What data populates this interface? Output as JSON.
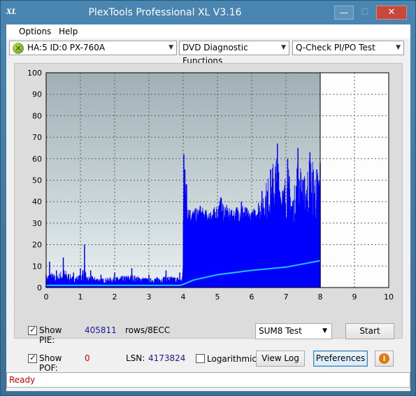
{
  "window": {
    "title": "PlexTools Professional XL V3.16",
    "icon_text": "XL",
    "min_glyph": "—",
    "max_glyph": "☐",
    "close_glyph": "✕"
  },
  "menu": {
    "options": "Options",
    "help": "Help"
  },
  "toolbar": {
    "device": "HA:5 ID:0  PX-760A",
    "function": "DVD Diagnostic Functions",
    "test": "Q-Check PI/PO Test"
  },
  "chart_data": {
    "type": "area",
    "x_ticks": [
      "0",
      "1",
      "2",
      "3",
      "4",
      "5",
      "6",
      "7",
      "8",
      "9",
      "10"
    ],
    "y_ticks": [
      "0",
      "10",
      "20",
      "30",
      "40",
      "50",
      "60",
      "70",
      "80",
      "90",
      "100"
    ],
    "xlim": [
      0,
      10
    ],
    "ylim": [
      0,
      100
    ],
    "grid": true,
    "cursor_x": 8,
    "colors": {
      "pie": "#0000ff",
      "cumulative": "#22c4ff",
      "bg_top": "#9fb0b5",
      "bg_bottom": "#e8eff0"
    },
    "series": [
      {
        "values_x": [
          0,
          0.1,
          0.3,
          0.5,
          0.8,
          1.0,
          1.12,
          1.15,
          1.3,
          1.6,
          2.0,
          2.5,
          3.0,
          3.5,
          3.9,
          3.98,
          4.02,
          4.05,
          4.1,
          4.2,
          4.5,
          4.8,
          5.1,
          5.4,
          5.7,
          6.0,
          6.3,
          6.55,
          6.75,
          6.9,
          7.05,
          7.2,
          7.35,
          7.5,
          7.7,
          7.9,
          8.0
        ],
        "values_y": [
          6,
          12,
          8,
          14,
          7,
          9,
          20,
          7,
          8,
          6,
          7,
          9,
          6,
          8,
          7,
          5,
          62,
          55,
          48,
          36,
          38,
          35,
          42,
          36,
          40,
          35,
          45,
          55,
          67,
          45,
          60,
          40,
          65,
          50,
          63,
          55,
          58
        ]
      },
      {
        "values_x": [
          0,
          1,
          2,
          3,
          3.9,
          4.0,
          4.3,
          5.0,
          6.0,
          7.0,
          8.0
        ],
        "values_y": [
          1,
          1,
          1,
          1,
          1,
          1.5,
          3.5,
          6,
          8,
          9.5,
          12.5
        ]
      }
    ]
  },
  "controls": {
    "show_pie_label": "Show PIE:",
    "pie_value": "405811",
    "pie_unit": "rows/8ECC",
    "show_pof_label": "Show POF:",
    "pof_value": "0",
    "lsn_label": "LSN:",
    "lsn_value": "4173824",
    "log_label": "Logarithmic",
    "sum_select": "SUM8 Test",
    "start": "Start",
    "view_log": "View Log",
    "preferences": "Preferences",
    "info_glyph": "i"
  },
  "status": "Ready"
}
